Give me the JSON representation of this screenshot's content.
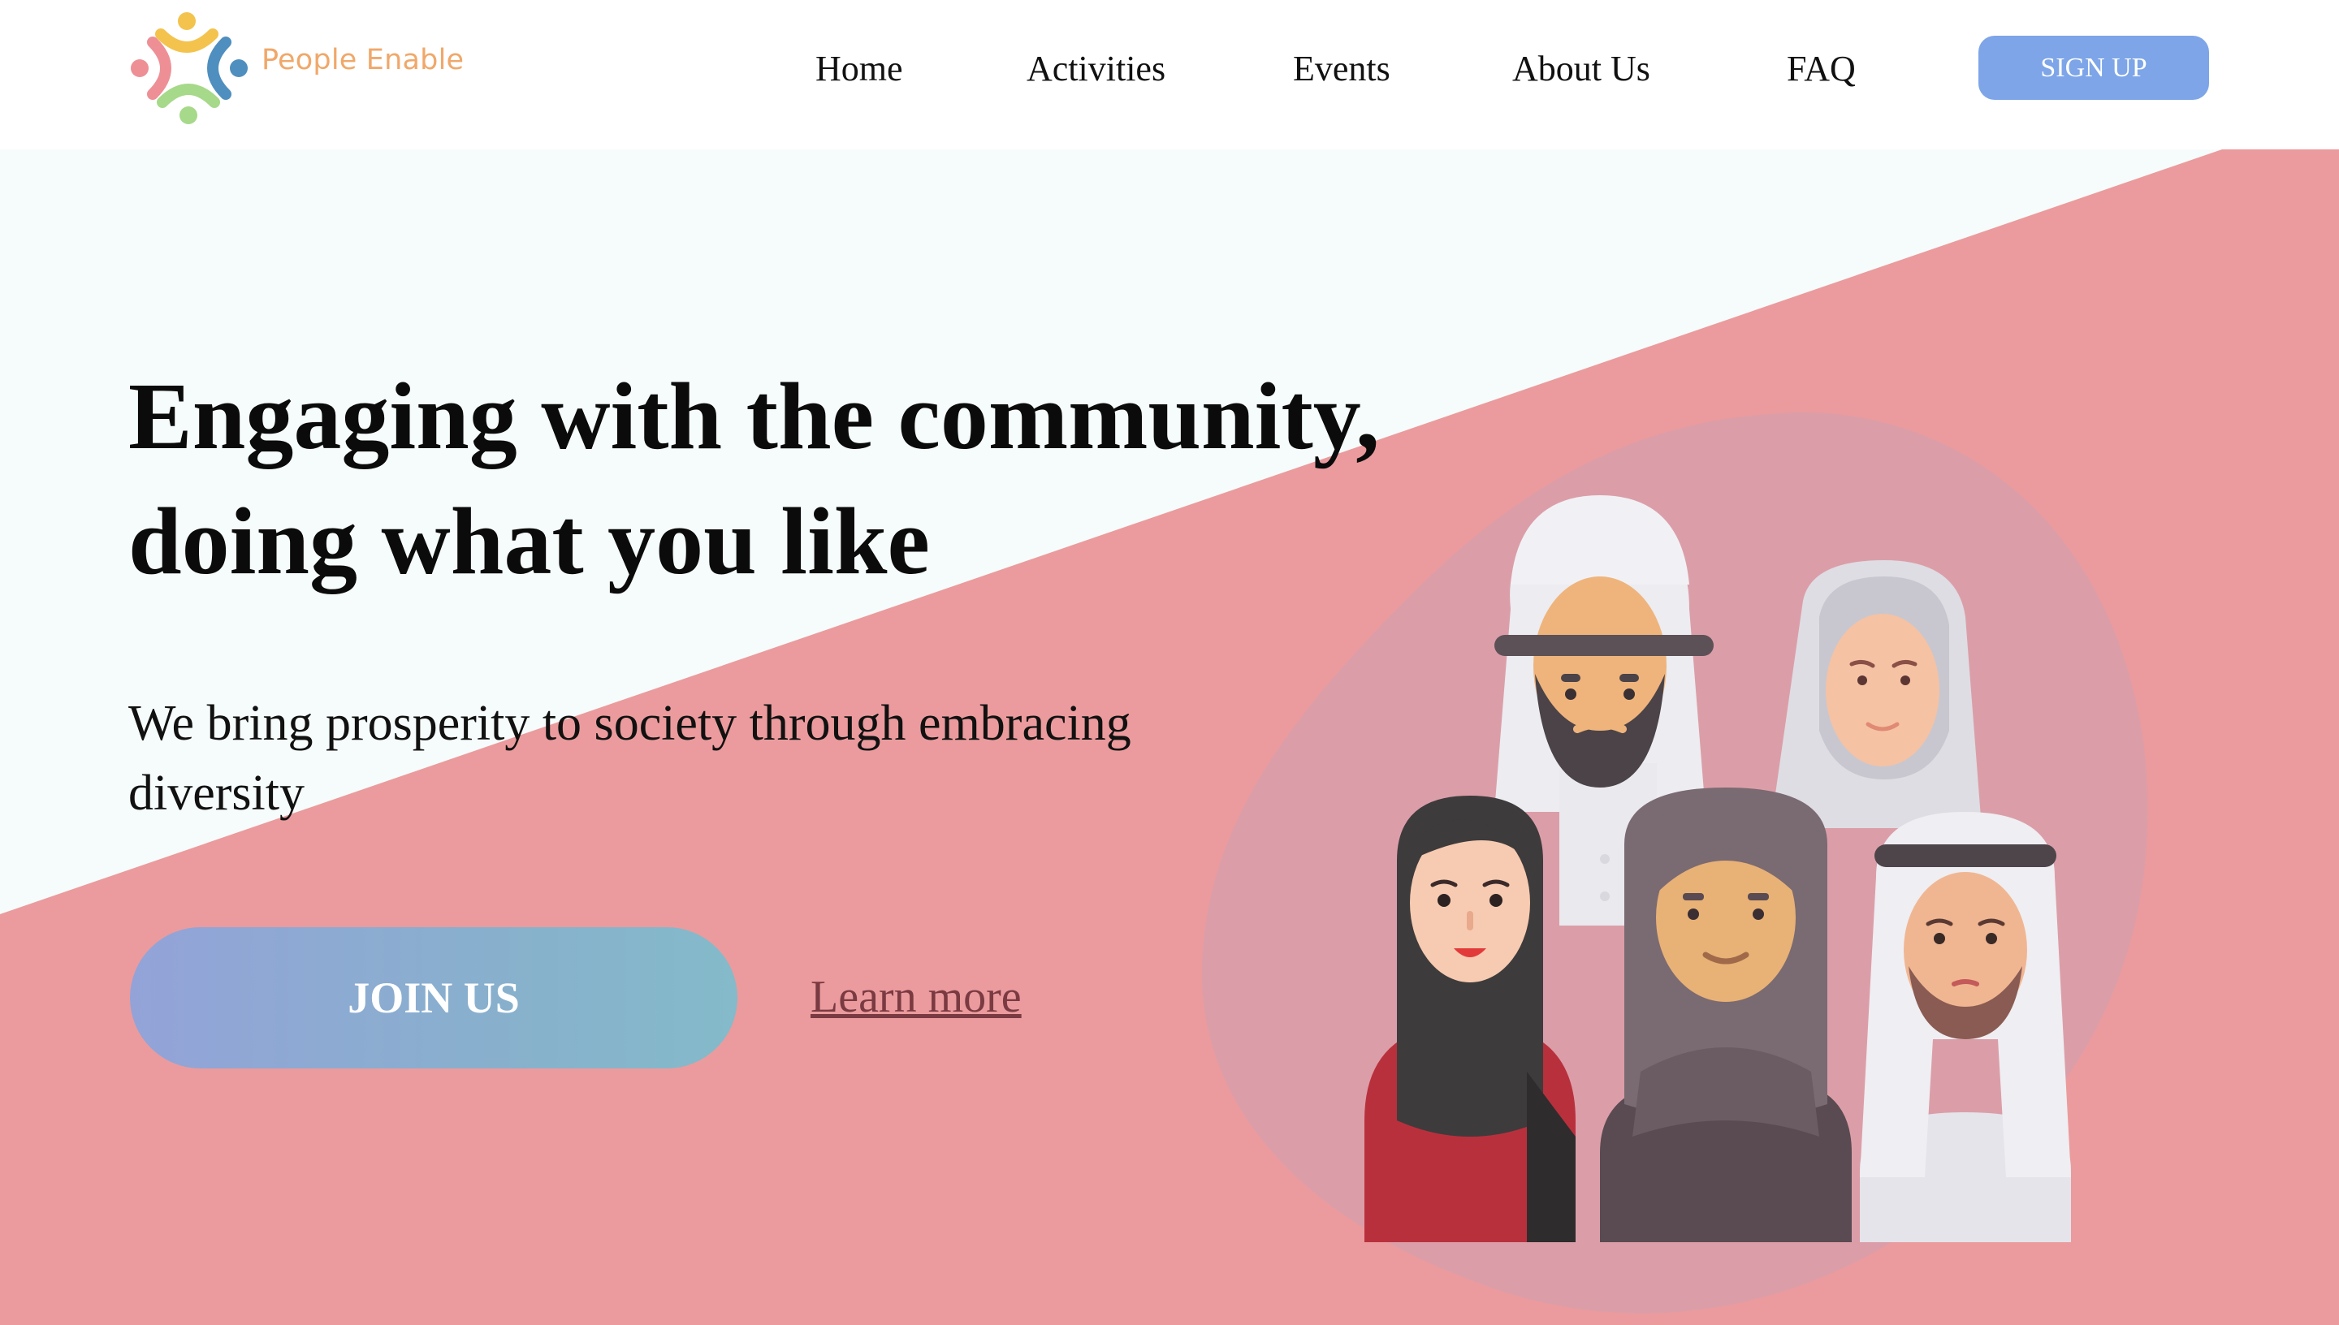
{
  "brand": {
    "name": "People Enable",
    "logo_icon": "people-circle-logo"
  },
  "nav": {
    "items": [
      {
        "label": "Home"
      },
      {
        "label": "Activities"
      },
      {
        "label": "Events"
      },
      {
        "label": "About Us"
      },
      {
        "label": "FAQ"
      }
    ],
    "signup_label": "SIGN UP"
  },
  "hero": {
    "headline_line1": "Engaging with the community,",
    "headline_line2": "doing what you like",
    "subtext": "We bring prosperity to society through embracing diversity",
    "join_label": "JOIN US",
    "learn_label": "Learn more",
    "illustration_icon": "diverse-people-group-illustration"
  },
  "colors": {
    "accent_pink": "#eb9b9d",
    "hero_light": "#f6fcfb",
    "signup_blue": "#7da5e8",
    "brand_orange": "#f0a86a"
  }
}
